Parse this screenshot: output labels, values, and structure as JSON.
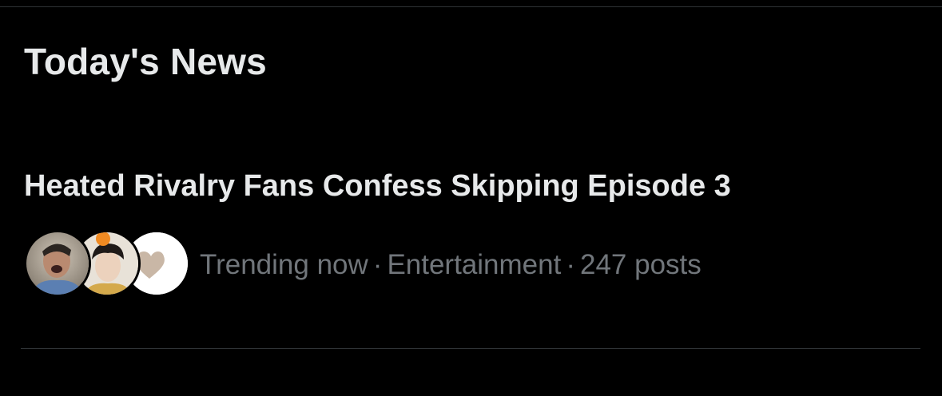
{
  "section": {
    "title": "Today's News"
  },
  "news_item": {
    "headline": "Heated Rivalry Fans Confess Skipping Episode 3",
    "status": "Trending now",
    "category": "Entertainment",
    "post_count": "247 posts",
    "separator": "·",
    "avatars": [
      {
        "name": "avatar-person-1"
      },
      {
        "name": "avatar-person-2"
      },
      {
        "name": "avatar-heart"
      }
    ]
  },
  "colors": {
    "background": "#000000",
    "primary_text": "#e7e9ea",
    "secondary_text": "#71767b",
    "divider": "#2f3336"
  }
}
